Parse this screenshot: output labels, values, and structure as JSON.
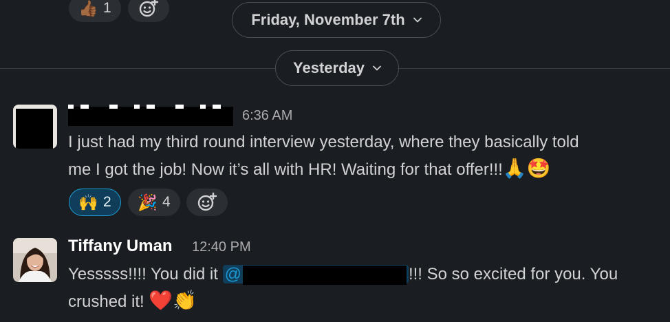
{
  "top_reactions": [
    {
      "emoji": "👍🏾",
      "count": "1"
    }
  ],
  "dividers": [
    {
      "label": "Friday, November 7th"
    },
    {
      "label": "Yesterday"
    }
  ],
  "messages": [
    {
      "time": "6:36 AM",
      "text_line1": "I just had my third round interview yesterday, where they basically told",
      "text_line2": "me I got the job! Now it’s all with HR! Waiting for that offer!!!",
      "trailing_emoji": "🙏🤩",
      "reactions": [
        {
          "emoji": "🙌",
          "count": "2"
        },
        {
          "emoji": "🎉",
          "count": "4"
        }
      ]
    },
    {
      "author": "Tiffany Uman",
      "time": "12:40 PM",
      "text_prefix": "Yesssss!!!! You did it ",
      "mention_at": "@",
      "text_suffix": "!!! So so excited for you. You",
      "text_line2": "crushed it! ",
      "trailing_emoji": "❤️👏"
    }
  ]
}
